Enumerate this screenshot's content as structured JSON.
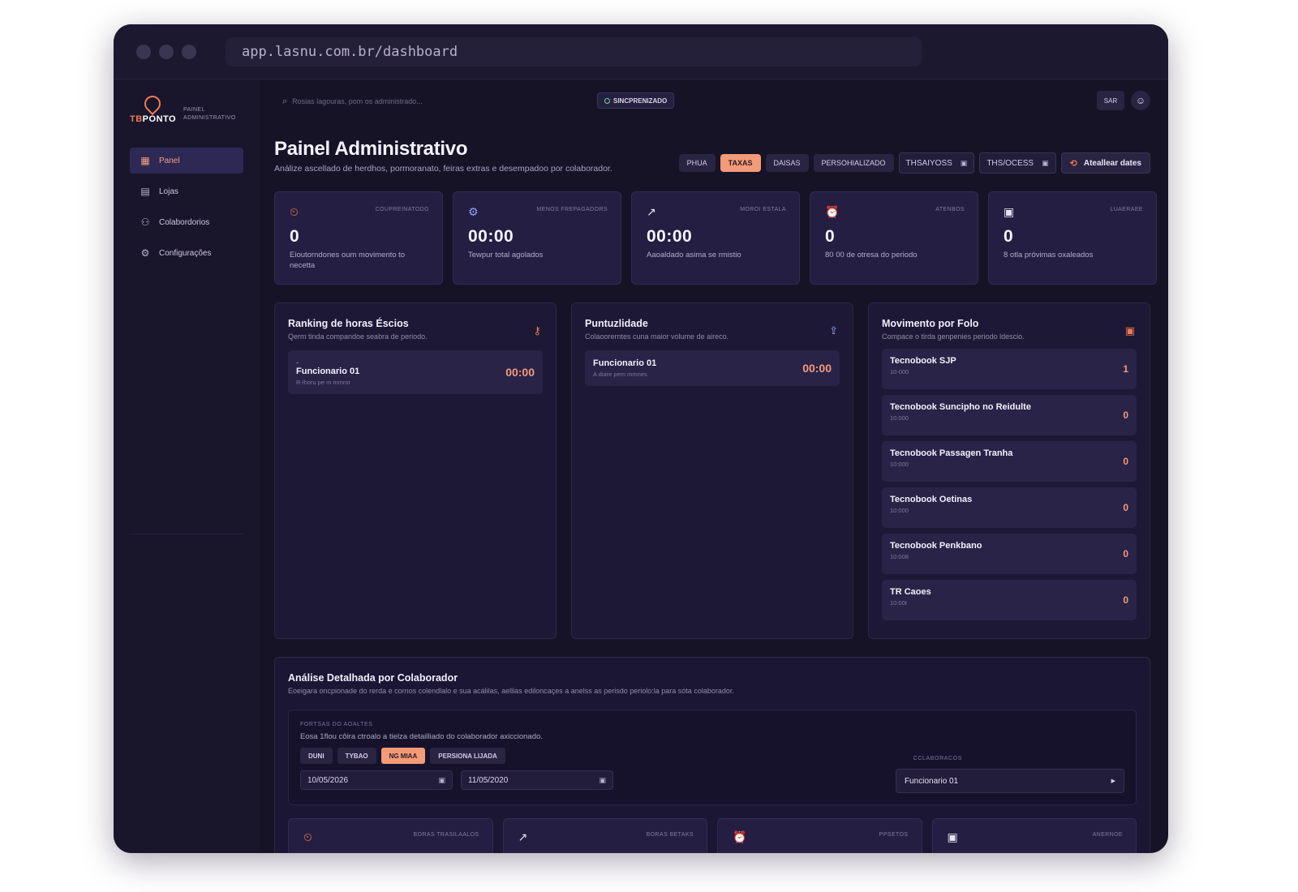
{
  "browser": {
    "url": "app.lasnu.com.br/dashboard"
  },
  "brand": {
    "name_first": "TB",
    "name_second": "PONTO",
    "subtitle_line1": "PAINEL",
    "subtitle_line2": "ADMINISTRATIVO"
  },
  "sidebar": {
    "items": [
      {
        "label": "Panel",
        "icon": "grid-icon",
        "active": true
      },
      {
        "label": "Lojas",
        "icon": "store-icon",
        "active": false
      },
      {
        "label": "Colabordorios",
        "icon": "users-icon",
        "active": false
      },
      {
        "label": "Configurações",
        "icon": "gear-icon",
        "active": false
      }
    ]
  },
  "topbar": {
    "search_placeholder": "Rosias lagouras, pom os administrado...",
    "sync_label": "SINCPRENIZADO",
    "sar_label": "SAR"
  },
  "header": {
    "title": "Painel Administrativo",
    "subtitle": "Análize ascellado de herdhos, pormoranato, feiras extras e desempadoo por colaborador."
  },
  "filters": {
    "chips": [
      {
        "label": "PHUA",
        "active": false
      },
      {
        "label": "TAXAS",
        "active": true
      },
      {
        "label": "DAISAS",
        "active": false
      },
      {
        "label": "PERSOHIALIZADO",
        "active": false
      }
    ],
    "date_from": "THSAIYOSS",
    "date_to": "THS/OCESS",
    "update_label": "Ateallear dates"
  },
  "stats": [
    {
      "icon": "clock-hand-icon",
      "label": "COUPREINATODG",
      "value": "0",
      "desc": "Eioutorndones oum movimento to necetta"
    },
    {
      "icon": "gear-icon",
      "label": "MENOS FREPAGADORS",
      "value": "00:00",
      "desc": "Tewpur total agolados"
    },
    {
      "icon": "trend-up-icon",
      "label": "MOROI ESTALA",
      "value": "00:00",
      "desc": "Aaoaldado asima se rmistio"
    },
    {
      "icon": "alarm-icon",
      "label": "ATENBOS",
      "value": "0",
      "desc": "80 00 de otresa do periodo"
    },
    {
      "icon": "calendar-check-icon",
      "label": "LUAERAEE",
      "value": "0",
      "desc": "8 otla próvimas oxaleados"
    }
  ],
  "ranking": {
    "title": "Ranking de horas Éscios",
    "subtitle": "Qerm tinda compandoe seabra de periodo.",
    "dash": "-",
    "name": "Funcionario 01",
    "meta": "R-lhoru pe m mmror",
    "value": "00:00"
  },
  "pontualidade": {
    "title": "Puntuzlidade",
    "subtitle": "Colaoorerntes cuna maior volume de aireco.",
    "name": "Funcionario 01",
    "meta": "A diare pem mmnes",
    "value": "00:00"
  },
  "movimento": {
    "title": "Movimento por Folo",
    "subtitle": "Compace o tirda genpenies periodo ldescio.",
    "lojas": [
      {
        "name": "Tecnobook SJP",
        "meta": "10-000",
        "value": "1"
      },
      {
        "name": "Tecnobook Suncipho no Reidulte",
        "meta": "10:000",
        "value": "0"
      },
      {
        "name": "Tecnobook Passagen Tranha",
        "meta": "10:000",
        "value": "0"
      },
      {
        "name": "Tecnobook Oetinas",
        "meta": "10:000",
        "value": "0"
      },
      {
        "name": "Tecnobook Penkbano",
        "meta": "10:008",
        "value": "0"
      },
      {
        "name": "TR Caoes",
        "meta": "10:00t",
        "value": "0"
      }
    ]
  },
  "detail": {
    "title": "Análise Detalhada por Colaborador",
    "subtitle": "Eoeigara oncpionade do rerda e cornos colendlalo e sua acálilas, aellias ediloncaçes a anelss as perisdo periolo:la para sóta colaborador.",
    "filter_label": "FORTSAS DO AOALTES",
    "filter_sub": "Eosa 1flou côira ctroalo a tielza detailliado do colaborador axiccionado.",
    "chips": [
      {
        "label": "DUNI",
        "active": false
      },
      {
        "label": "TYBAO",
        "active": false
      },
      {
        "label": "NG MIAA",
        "active": true
      },
      {
        "label": "PERSIONA LIJADA",
        "active": false
      }
    ],
    "date_from": "10/05/2026",
    "date_to": "11/05/2020",
    "collab_label": "CCLABORACOS",
    "collab_value": "Funcionario 01"
  },
  "bottom_stats": [
    {
      "icon": "clock-hand-icon",
      "label": "BORAS TRASILAALOS"
    },
    {
      "icon": "arrow-up-right-icon",
      "label": "BORAS BETAKS"
    },
    {
      "icon": "alarm-icon",
      "label": "PPSETOS"
    },
    {
      "icon": "calendar-icon",
      "label": "ANERNOE"
    }
  ],
  "colors": {
    "accent": "#f39a78",
    "accent_strong": "#f07a52",
    "background": "#171327",
    "card": "#241e42",
    "blue_icon": "#8fa6ff"
  }
}
